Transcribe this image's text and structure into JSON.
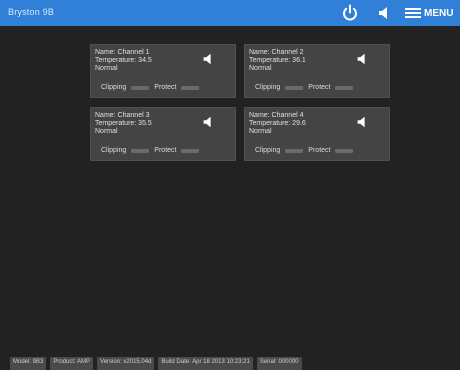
{
  "header": {
    "brand": "Bryston 9B",
    "menu_label": "MENU",
    "power_icon": "power-icon",
    "speaker_icon": "speaker-icon",
    "accent_color": "#2f80d6"
  },
  "channels": [
    {
      "name": "Name: Channel 1",
      "temperature": "Temperature: 34.5",
      "status": "Normal",
      "clipping_label": "Clipping",
      "protect_label": "Protect"
    },
    {
      "name": "Name: Channel 2",
      "temperature": "Temperature: 36.1",
      "status": "Normal",
      "clipping_label": "Clipping",
      "protect_label": "Protect"
    },
    {
      "name": "Name: Channel 3",
      "temperature": "Temperature: 35.5",
      "status": "Normal",
      "clipping_label": "Clipping",
      "protect_label": "Protect"
    },
    {
      "name": "Name: Channel 4",
      "temperature": "Temperature: 29.6",
      "status": "Normal",
      "clipping_label": "Clipping",
      "protect_label": "Protect"
    }
  ],
  "footer": {
    "model": "Model: 9B3",
    "product": "Product: AMP",
    "version": "Version: v2015.04d",
    "build_date": "Build Date: Apr 18 2013 10:23:21",
    "serial": "Serial: 000000"
  }
}
